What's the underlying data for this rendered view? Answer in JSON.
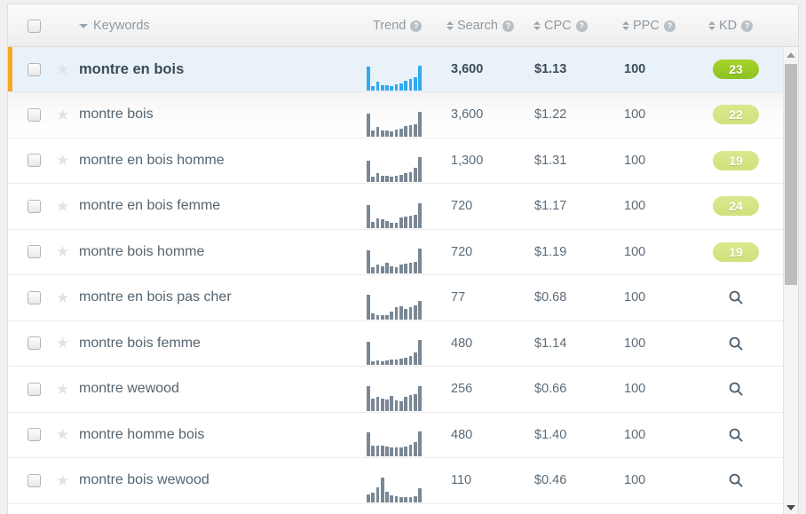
{
  "table": {
    "columns": {
      "keywords": "Keywords",
      "trend": "Trend",
      "search": "Search",
      "cpc": "CPC",
      "ppc": "PPC",
      "kd": "KD",
      "help_glyph": "?"
    },
    "rows": [
      {
        "keyword": "montre en bois",
        "search": "3,600",
        "cpc": "$1.13",
        "ppc": "100",
        "kd": "23",
        "kd_type": "badge-strong",
        "trend": [
          95,
          18,
          34,
          20,
          22,
          18,
          26,
          30,
          38,
          48,
          52,
          100
        ]
      },
      {
        "keyword": "montre bois",
        "search": "3,600",
        "cpc": "$1.22",
        "ppc": "100",
        "kd": "22",
        "kd_type": "badge-soft",
        "trend": [
          90,
          24,
          38,
          24,
          22,
          20,
          26,
          32,
          40,
          46,
          48,
          100
        ]
      },
      {
        "keyword": "montre en bois homme",
        "search": "1,300",
        "cpc": "$1.31",
        "ppc": "100",
        "kd": "19",
        "kd_type": "badge-soft",
        "trend": [
          86,
          20,
          34,
          26,
          24,
          22,
          24,
          28,
          34,
          40,
          58,
          100
        ]
      },
      {
        "keyword": "montre en bois femme",
        "search": "720",
        "cpc": "$1.17",
        "ppc": "100",
        "kd": "24",
        "kd_type": "badge-soft",
        "trend": [
          90,
          22,
          36,
          34,
          28,
          20,
          18,
          40,
          46,
          50,
          52,
          100
        ]
      },
      {
        "keyword": "montre bois homme",
        "search": "720",
        "cpc": "$1.19",
        "ppc": "100",
        "kd": "19",
        "kd_type": "badge-soft",
        "trend": [
          94,
          26,
          34,
          30,
          44,
          28,
          26,
          34,
          40,
          44,
          46,
          100
        ]
      },
      {
        "keyword": "montre en bois pas cher",
        "search": "77",
        "cpc": "$0.68",
        "ppc": "100",
        "kd": "",
        "kd_type": "search-icon",
        "trend": [
          96,
          22,
          16,
          14,
          14,
          30,
          46,
          50,
          40,
          48,
          52,
          70
        ]
      },
      {
        "keyword": "montre bois femme",
        "search": "480",
        "cpc": "$1.14",
        "ppc": "100",
        "kd": "",
        "kd_type": "search-icon",
        "trend": [
          92,
          16,
          18,
          16,
          18,
          20,
          22,
          26,
          30,
          36,
          50,
          100
        ]
      },
      {
        "keyword": "montre wewood",
        "search": "256",
        "cpc": "$0.66",
        "ppc": "100",
        "kd": "",
        "kd_type": "search-icon",
        "trend": [
          90,
          44,
          50,
          46,
          42,
          54,
          38,
          36,
          52,
          58,
          62,
          92
        ]
      },
      {
        "keyword": "montre homme bois",
        "search": "480",
        "cpc": "$1.40",
        "ppc": "100",
        "kd": "",
        "kd_type": "search-icon",
        "trend": [
          92,
          40,
          42,
          40,
          38,
          36,
          34,
          34,
          38,
          46,
          54,
          96
        ]
      },
      {
        "keyword": "montre bois wewood",
        "search": "110",
        "cpc": "$0.46",
        "ppc": "100",
        "kd": "",
        "kd_type": "search-icon",
        "trend": [
          30,
          36,
          58,
          98,
          40,
          26,
          22,
          20,
          18,
          18,
          24,
          54
        ]
      }
    ]
  },
  "colors": {
    "accent_bar": "#f5a623",
    "selected_row_bg": "#eaf2f9",
    "spark_active": "#33a9ef",
    "spark_idle": "#7a8794",
    "kd_strong": "#8cc220",
    "kd_soft": "#cfe27b"
  },
  "scrollbar": {
    "up_arrow": "scroll-up",
    "down_arrow": "scroll-down"
  }
}
